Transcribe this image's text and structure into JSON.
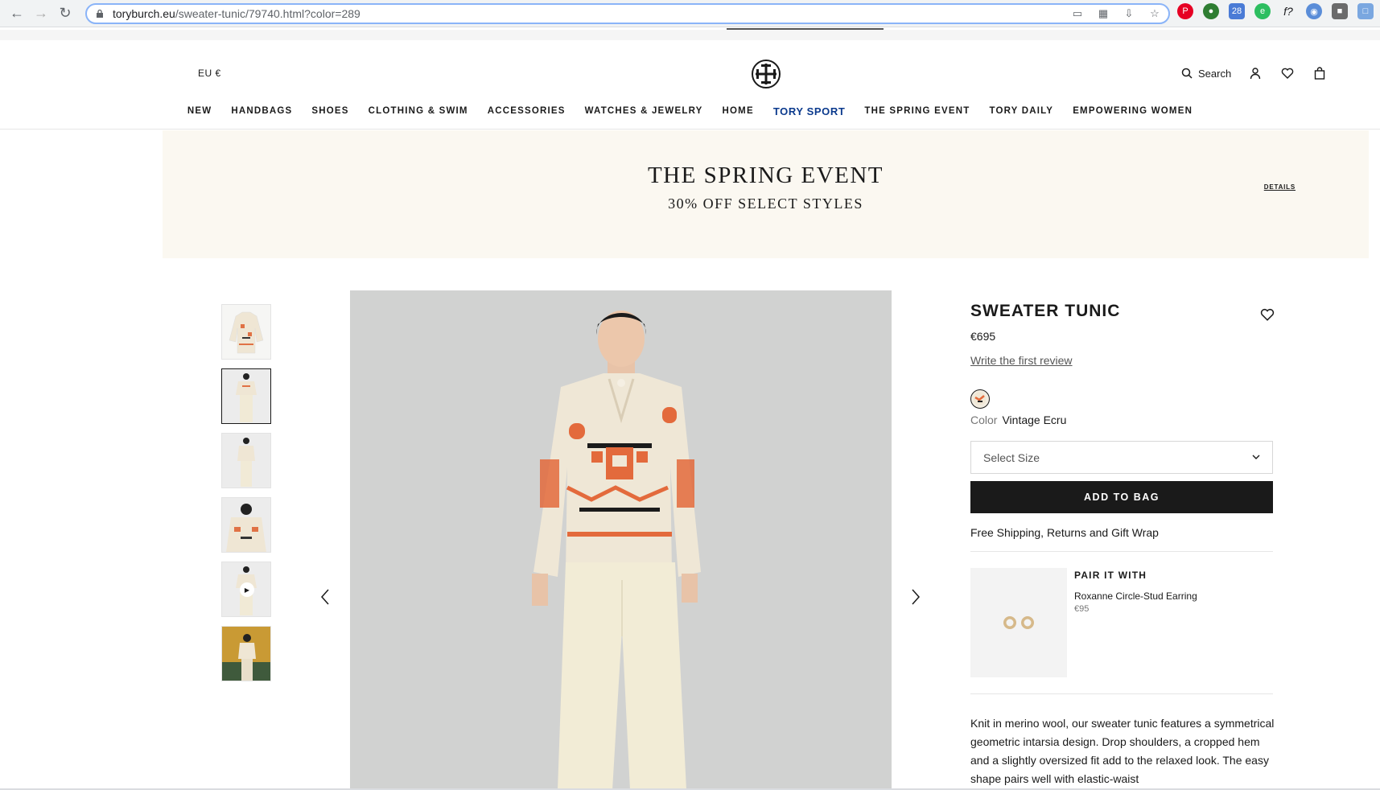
{
  "browser": {
    "url_host": "toryburch.eu",
    "url_path": "/sweater-tunic/79740.html?color=289"
  },
  "header": {
    "locale": "EU €",
    "search_label": "Search",
    "nav": [
      "NEW",
      "HANDBAGS",
      "SHOES",
      "CLOTHING & SWIM",
      "ACCESSORIES",
      "WATCHES & JEWELRY",
      "HOME",
      "TORY SPORT",
      "THE SPRING EVENT",
      "TORY DAILY",
      "EMPOWERING WOMEN"
    ],
    "highlight_color": "#0b3a8d"
  },
  "promo": {
    "title": "THE SPRING EVENT",
    "subtitle": "30% OFF SELECT STYLES",
    "details": "DETAILS",
    "background": "#fbf8f1"
  },
  "product": {
    "name": "SWEATER TUNIC",
    "price": "€695",
    "review_link": "Write the first review",
    "color_label": "Color",
    "color_value": "Vintage Ecru",
    "size_placeholder": "Select Size",
    "add_to_bag": "ADD TO BAG",
    "shipping": "Free Shipping, Returns and Gift Wrap",
    "description": "Knit in merino wool, our sweater tunic features a symmetrical geometric intarsia design. Drop shoulders, a cropped hem and a slightly oversized fit add to the relaxed look. The easy shape pairs well with elastic-waist"
  },
  "pair": {
    "title": "PAIR IT WITH",
    "name": "Roxanne Circle-Stud Earring",
    "price": "€95"
  }
}
